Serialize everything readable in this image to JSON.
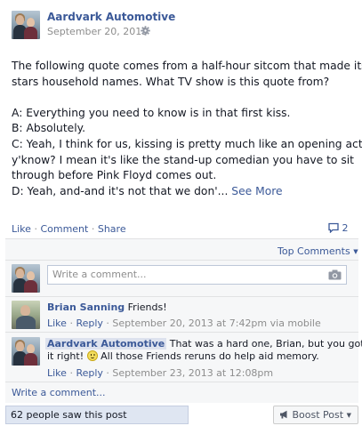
{
  "post": {
    "page_name": "Aardvark Automotive",
    "date": "September 20, 2013",
    "audience_icon": "gear-icon",
    "text_lines": [
      "The following quote comes from a half-hour sitcom that made its",
      "stars household names. What TV show is this quote from?",
      "",
      "A: Everything you need to know is in that first kiss.",
      "B: Absolutely.",
      "C: Yeah, I think for us, kissing is pretty much like an opening act,",
      "y'know? I mean it's like the stand-up comedian you have to sit",
      "through before Pink Floyd comes out.",
      "D: Yeah, and-and it's not that we don'..."
    ],
    "see_more": "See More"
  },
  "actions": {
    "like": "Like",
    "comment": "Comment",
    "share": "Share",
    "separator": "·",
    "share_count": "2",
    "top_comments": "Top Comments",
    "top_comments_arrow": "▼"
  },
  "composer": {
    "placeholder": "Write a comment...",
    "camera_icon": "camera-icon"
  },
  "comments": [
    {
      "author": "Brian Sanning",
      "text": "Friends!",
      "like": "Like",
      "reply": "Reply",
      "meta": "September 20, 2013 at 7:42pm via mobile"
    },
    {
      "author": "Aardvark Automotive",
      "text_part1": "That was a hard one, Brian, but you got",
      "text_part2": "it right!",
      "text_part3": "All those Friends reruns do help aid memory.",
      "like": "Like",
      "reply": "Reply",
      "meta": "September 23, 2013 at 12:08pm"
    }
  ],
  "write_comment": "Write a comment...",
  "footer": {
    "reach": "62 people saw this post",
    "boost": "Boost Post",
    "boost_arrow": "▼"
  },
  "colors": {
    "link": "#3b5998",
    "meta": "#8d8d8d",
    "feedback_bg": "#f6f7f8"
  }
}
